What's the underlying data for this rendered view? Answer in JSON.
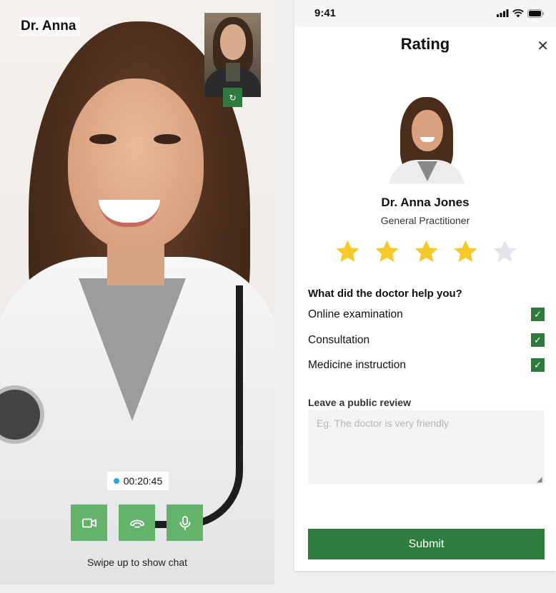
{
  "call": {
    "caller_name": "Dr. Anna",
    "timer": "00:20:45",
    "swipe_hint": "Swipe up to show chat",
    "controls": [
      {
        "icon": "video-camera-icon"
      },
      {
        "icon": "hang-up-phone-icon"
      },
      {
        "icon": "microphone-icon"
      }
    ],
    "pip_switch_icon": "camera-switch-icon"
  },
  "panel": {
    "status_time": "9:41",
    "title": "Rating",
    "close_icon": "close-icon",
    "doctor_name": "Dr. Anna Jones",
    "doctor_role": "General Practitioner",
    "rating": {
      "value": 4,
      "max": 5
    },
    "question": "What did the doctor help you?",
    "options": [
      {
        "label": "Online examination",
        "checked": true
      },
      {
        "label": "Consultation",
        "checked": true
      },
      {
        "label": "Medicine instruction",
        "checked": true
      }
    ],
    "review_label": "Leave a public review",
    "review_placeholder": "Eg. The doctor is very friendly",
    "submit_label": "Submit"
  },
  "colors": {
    "accent_green": "#2e7d3e",
    "control_green": "#64b36b",
    "star_filled": "#f7c928",
    "star_empty": "#e2e4e8",
    "timer_dot": "#2aa6d8"
  }
}
